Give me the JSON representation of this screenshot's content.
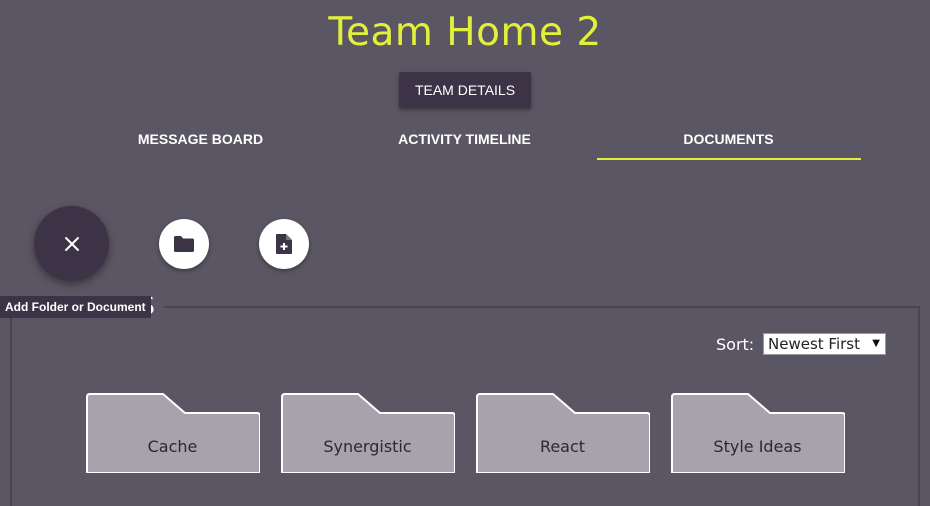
{
  "header": {
    "title": "Team Home 2",
    "team_details_label": "TEAM DETAILS"
  },
  "tabs": [
    {
      "label": "MESSAGE BOARD",
      "active": false
    },
    {
      "label": "ACTIVITY TIMELINE",
      "active": false
    },
    {
      "label": "DOCUMENTS",
      "active": true
    }
  ],
  "actions": {
    "main_icon": "close-icon",
    "folder_icon": "folder-icon",
    "document_icon": "add-document-icon",
    "tooltip": "Add Folder or Document"
  },
  "section": {
    "legend_visible": "RS"
  },
  "sort": {
    "label": "Sort:",
    "selected": "Newest First"
  },
  "folders": [
    {
      "name": "Cache"
    },
    {
      "name": "Synergistic"
    },
    {
      "name": "React"
    },
    {
      "name": "Style Ideas"
    }
  ],
  "colors": {
    "background": "#5b5663",
    "accent": "#e3f03b",
    "dark": "#3d3346",
    "folder": "#a8a2ad"
  }
}
